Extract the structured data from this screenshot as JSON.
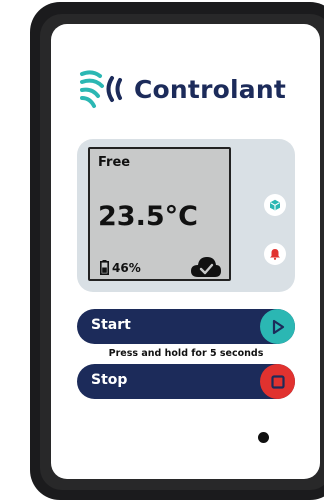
{
  "brand": {
    "name": "Controlant"
  },
  "display": {
    "mode": "Free",
    "temperature": "23.5°C",
    "battery": "46%"
  },
  "controls": {
    "start_label": "Start",
    "stop_label": "Stop",
    "hint": "Press and hold for 5 seconds"
  },
  "icons": {
    "logo": "controlant-wave-logo",
    "battery": "battery-icon",
    "cloud": "cloud-check-icon",
    "cube": "cube-icon",
    "bell": "bell-icon",
    "play": "play-icon",
    "stop": "stop-square-icon"
  },
  "colors": {
    "navy": "#1c2b5a",
    "teal": "#2bb7b3",
    "red": "#e1322f",
    "panel": "#d9e0e5",
    "lcd": "#c8c9c9"
  }
}
